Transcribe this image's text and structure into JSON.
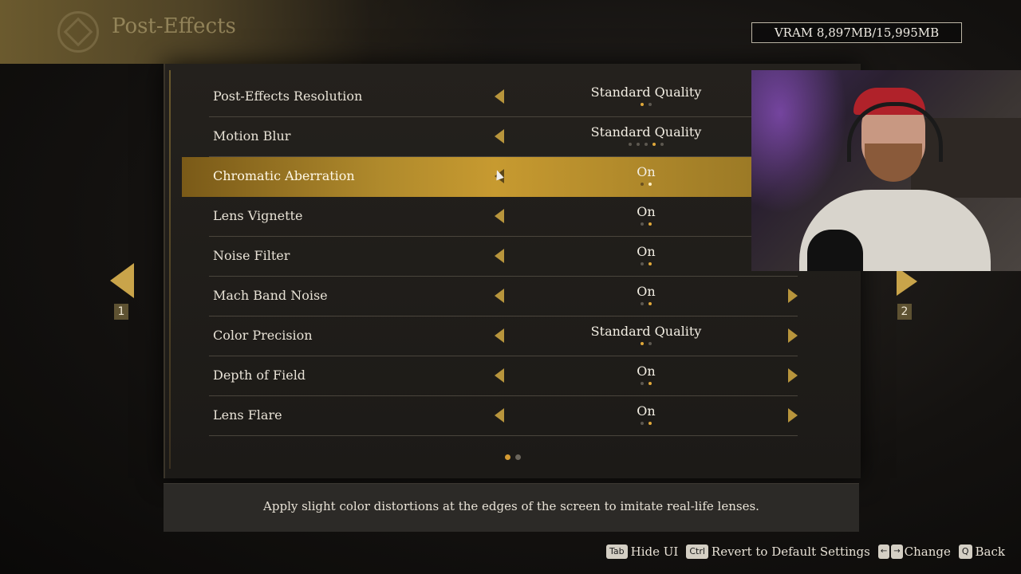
{
  "header": {
    "title": "Post-Effects"
  },
  "vram": "VRAM 8,897MB/15,995MB",
  "settings": [
    {
      "label": "Post-Effects Resolution",
      "value": "Standard Quality",
      "dots": 2,
      "active": 0,
      "right_arrow": false,
      "selected": false
    },
    {
      "label": "Motion Blur",
      "value": "Standard Quality",
      "dots": 5,
      "active": 3,
      "right_arrow": false,
      "selected": false
    },
    {
      "label": "Chromatic Aberration",
      "value": "On",
      "dots": 2,
      "active": 1,
      "right_arrow": false,
      "selected": true
    },
    {
      "label": "Lens Vignette",
      "value": "On",
      "dots": 2,
      "active": 1,
      "right_arrow": false,
      "selected": false
    },
    {
      "label": "Noise Filter",
      "value": "On",
      "dots": 2,
      "active": 1,
      "right_arrow": false,
      "selected": false
    },
    {
      "label": "Mach Band Noise",
      "value": "On",
      "dots": 2,
      "active": 1,
      "right_arrow": true,
      "selected": false
    },
    {
      "label": "Color Precision",
      "value": "Standard Quality",
      "dots": 2,
      "active": 0,
      "right_arrow": true,
      "selected": false
    },
    {
      "label": "Depth of Field",
      "value": "On",
      "dots": 2,
      "active": 1,
      "right_arrow": true,
      "selected": false
    },
    {
      "label": "Lens Flare",
      "value": "On",
      "dots": 2,
      "active": 1,
      "right_arrow": true,
      "selected": false
    }
  ],
  "pagination": {
    "pages": 2,
    "current": 1,
    "prev_page": "1",
    "next_page": "2"
  },
  "description": "Apply slight color distortions at the edges of the screen to imitate real-life lenses.",
  "footer": [
    {
      "keys": [
        "Tab"
      ],
      "label": "Hide UI"
    },
    {
      "keys": [
        "Ctrl"
      ],
      "label": "Revert to Default Settings"
    },
    {
      "keys": [
        "←",
        "→"
      ],
      "label": "Change"
    },
    {
      "keys": [
        "Q"
      ],
      "label": "Back"
    }
  ],
  "colors": {
    "accent": "#c79a30",
    "dot_active": "#e0a83a"
  }
}
